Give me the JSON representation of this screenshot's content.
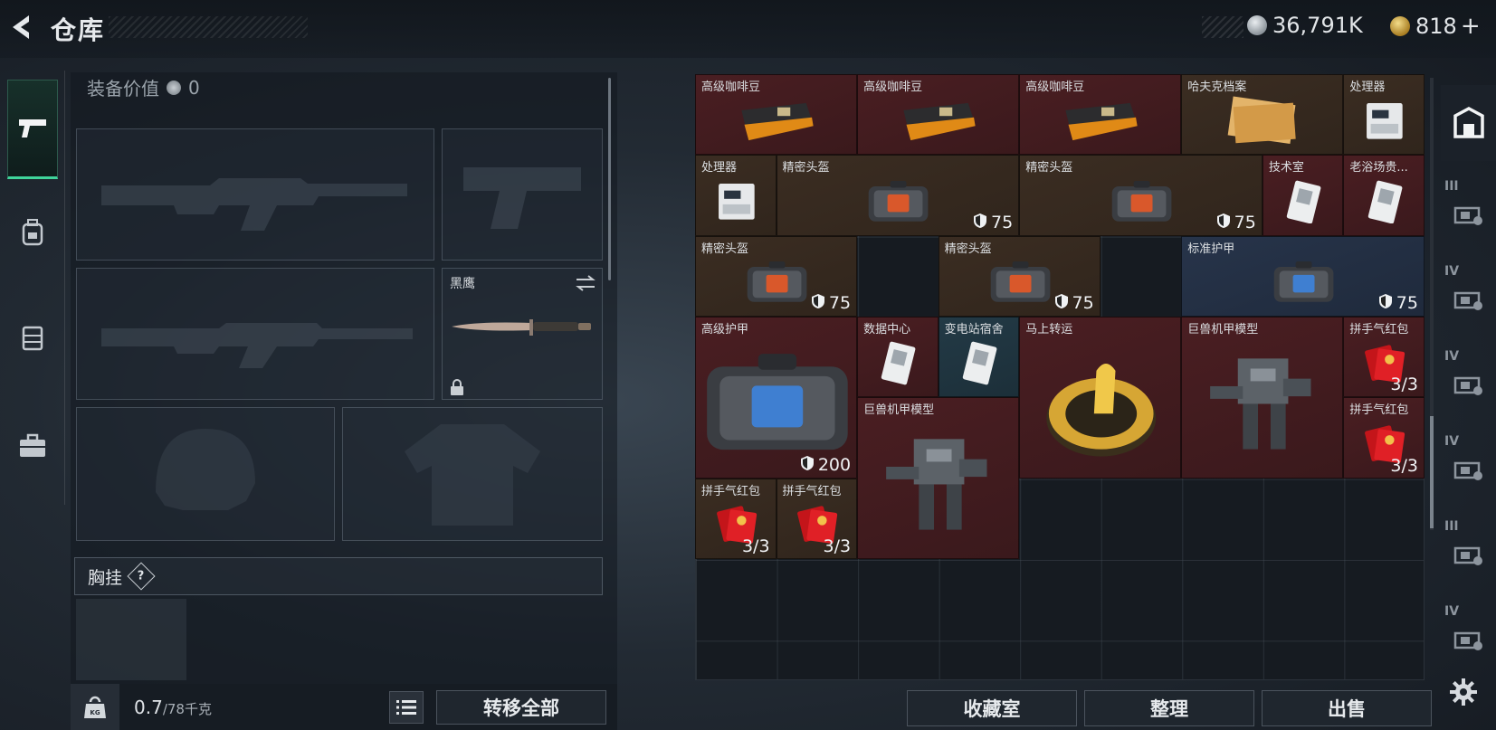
{
  "header": {
    "title": "仓库",
    "currency_coins": "36,791K",
    "currency_gold": "818"
  },
  "equipment": {
    "value_label": "装备价值",
    "value": "0",
    "knife_name": "黑鹰",
    "chest_label": "胸挂",
    "help": "?"
  },
  "footer": {
    "weight": "0.7",
    "weight_max": "/78千克",
    "transfer_all": "转移全部",
    "collection": "收藏室",
    "organize": "整理",
    "sell": "出售"
  },
  "rail": {
    "labels": [
      "III",
      "IV",
      "IV",
      "IV",
      "III",
      "IV"
    ]
  },
  "inventory": [
    {
      "name": "高级咖啡豆",
      "color": "red",
      "icon": "coffee-tin-icon",
      "qty": ""
    },
    {
      "name": "高级咖啡豆",
      "color": "red",
      "icon": "coffee-tin-icon",
      "qty": ""
    },
    {
      "name": "高级咖啡豆",
      "color": "red",
      "icon": "coffee-tin-icon",
      "qty": ""
    },
    {
      "name": "哈夫克档案",
      "color": "brown",
      "icon": "document-icon",
      "qty": ""
    },
    {
      "name": "处理器",
      "color": "brown",
      "icon": "processor-icon",
      "qty": ""
    },
    {
      "name": "处理器",
      "color": "brown",
      "icon": "processor-icon",
      "qty": ""
    },
    {
      "name": "精密头盔",
      "color": "brown",
      "icon": "helmet-case-icon",
      "qty": "75"
    },
    {
      "name": "精密头盔",
      "color": "brown",
      "icon": "helmet-case-icon",
      "qty": "75"
    },
    {
      "name": "技术室",
      "color": "red",
      "icon": "keycard-icon",
      "qty": ""
    },
    {
      "name": "老浴场贵...",
      "color": "red",
      "icon": "keycard-icon",
      "qty": ""
    },
    {
      "name": "精密头盔",
      "color": "brown",
      "icon": "helmet-case-icon",
      "qty": "75"
    },
    {
      "name": "精密头盔",
      "color": "brown",
      "icon": "helmet-case-icon",
      "qty": "75"
    },
    {
      "name": "标准护甲",
      "color": "blue",
      "icon": "armor-case-icon",
      "qty": "75"
    },
    {
      "name": "高级护甲",
      "color": "red",
      "icon": "armor-case-icon",
      "qty": "200"
    },
    {
      "name": "数据中心",
      "color": "red",
      "icon": "keycard-icon",
      "qty": ""
    },
    {
      "name": "变电站宿舍",
      "color": "teal",
      "icon": "keycard-icon",
      "qty": ""
    },
    {
      "name": "马上转运",
      "color": "red",
      "icon": "horse-medal-icon",
      "qty": ""
    },
    {
      "name": "巨兽机甲模型",
      "color": "red",
      "icon": "mech-icon",
      "qty": ""
    },
    {
      "name": "拼手气红包",
      "color": "red",
      "icon": "red-envelope-icon",
      "qty": "3/3"
    },
    {
      "name": "巨兽机甲模型",
      "color": "red",
      "icon": "mech-icon",
      "qty": ""
    },
    {
      "name": "拼手气红包",
      "color": "red",
      "icon": "red-envelope-icon",
      "qty": "3/3"
    },
    {
      "name": "拼手气红包",
      "color": "brown",
      "icon": "red-envelope-icon",
      "qty": "3/3"
    },
    {
      "name": "拼手气红包",
      "color": "brown",
      "icon": "red-envelope-icon",
      "qty": "3/3"
    }
  ]
}
